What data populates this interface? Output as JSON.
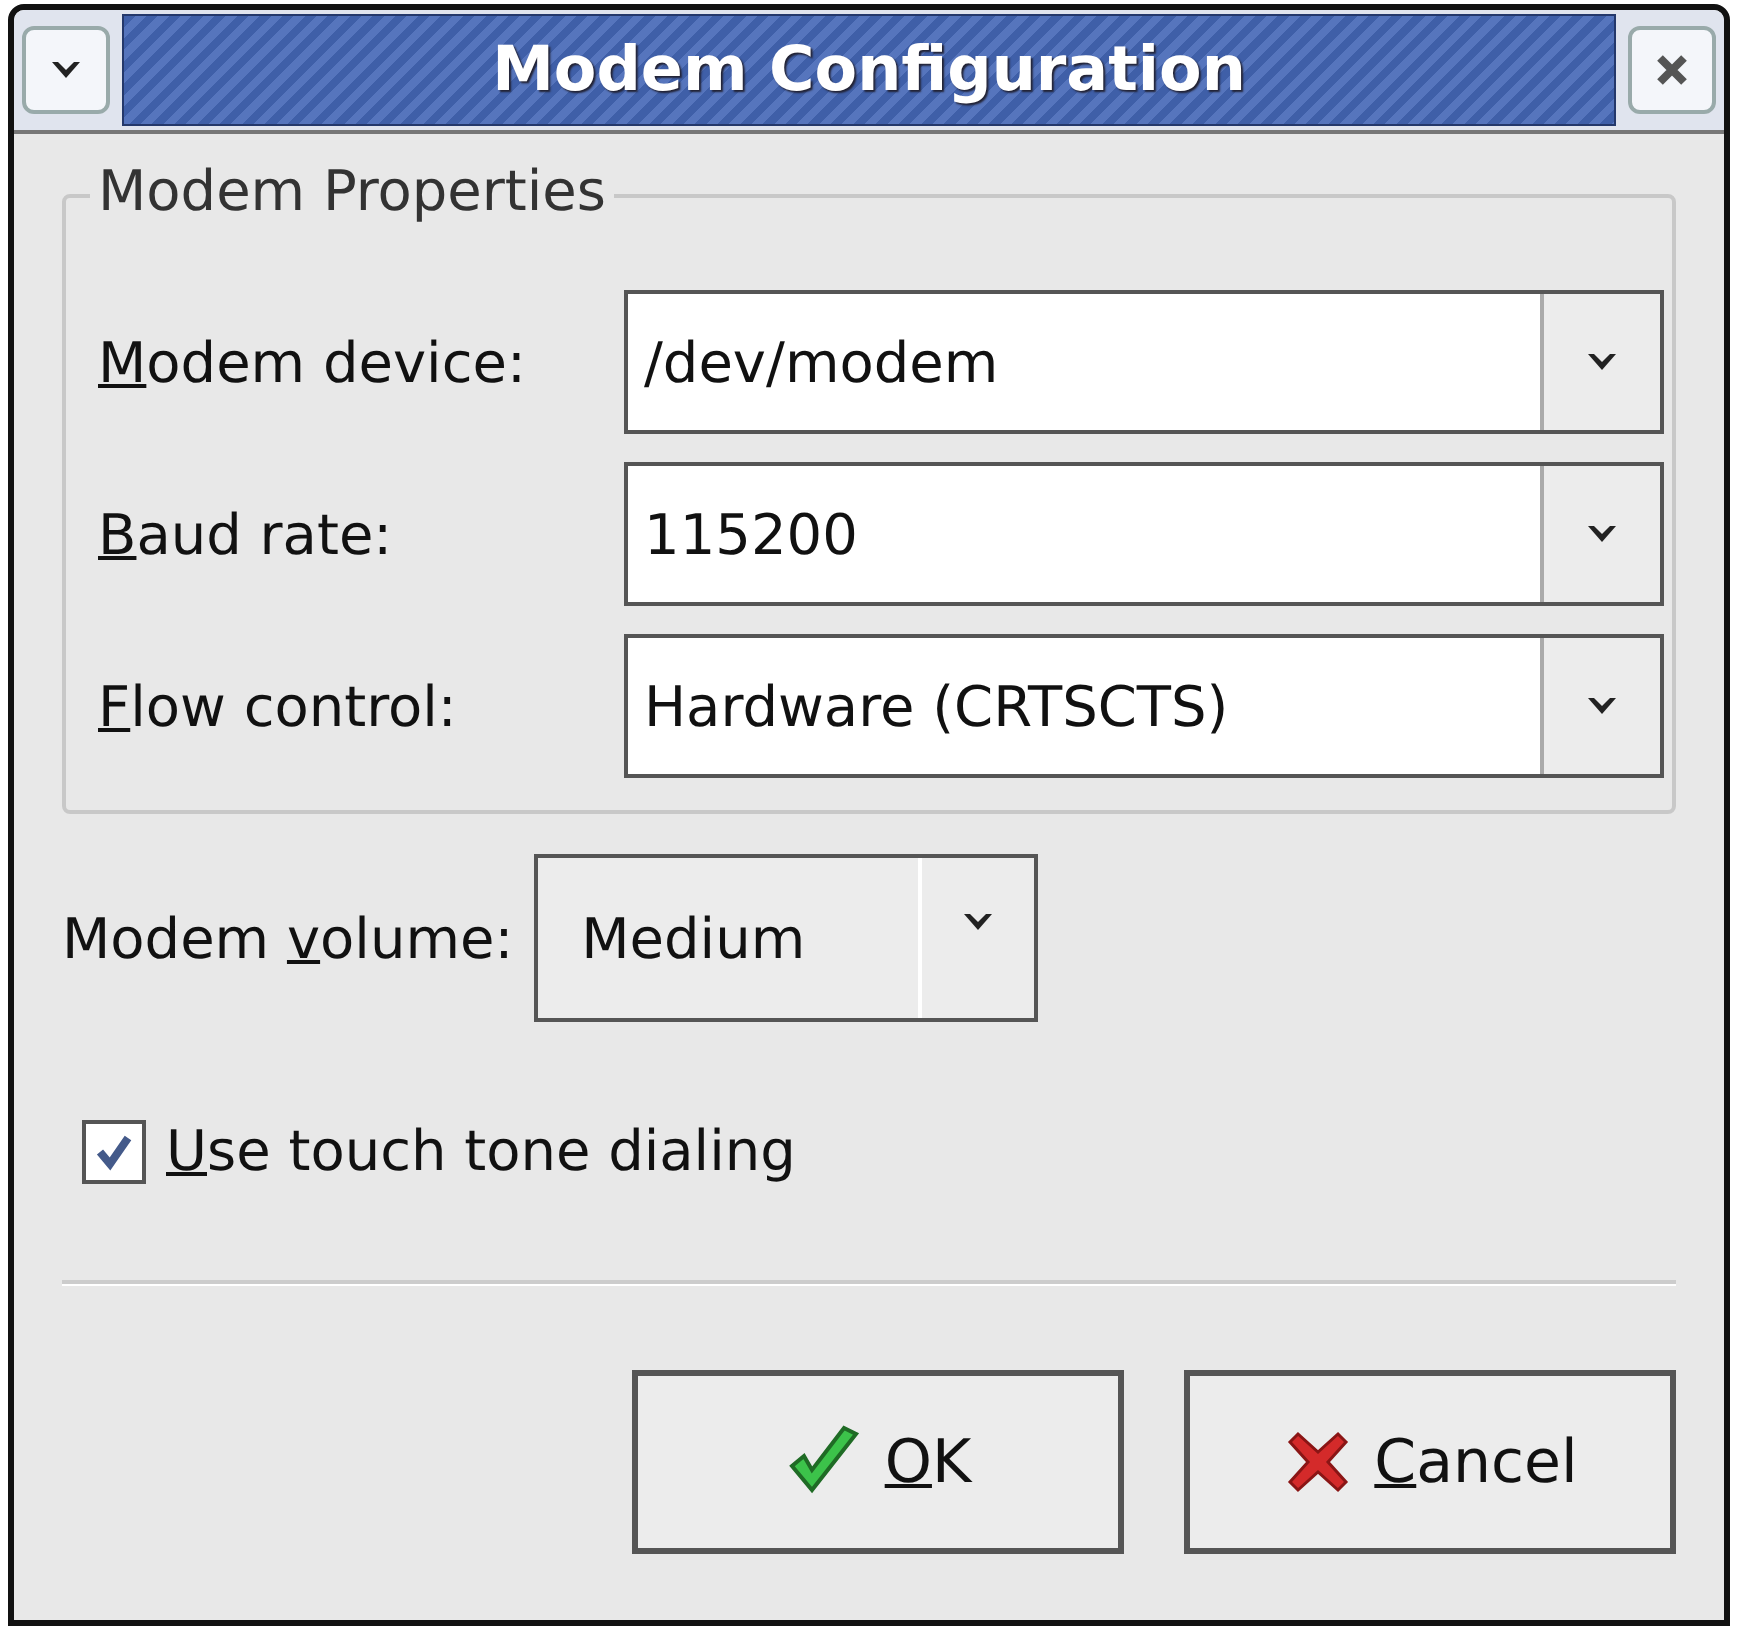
{
  "window": {
    "title": "Modem Configuration"
  },
  "group": {
    "title": "Modem Properties"
  },
  "fields": [
    {
      "label": {
        "key": "M",
        "after": "odem device:"
      },
      "value": "/dev/modem"
    },
    {
      "label": {
        "key": "B",
        "after": "aud rate:"
      },
      "value": "115200"
    },
    {
      "label": {
        "key": "F",
        "after": "low control:"
      },
      "value": "Hardware (CRTSCTS)"
    }
  ],
  "volume": {
    "label": {
      "before": "Modem ",
      "key": "v",
      "after": "olume:"
    },
    "value": "Medium"
  },
  "touch_tone": {
    "label": {
      "key": "U",
      "after": "se touch tone dialing"
    },
    "checked": true
  },
  "buttons": [
    {
      "kind": "ok",
      "label": {
        "key": "O",
        "after": "K"
      }
    },
    {
      "kind": "cancel",
      "label": {
        "key": "C",
        "after": "ancel"
      }
    }
  ]
}
